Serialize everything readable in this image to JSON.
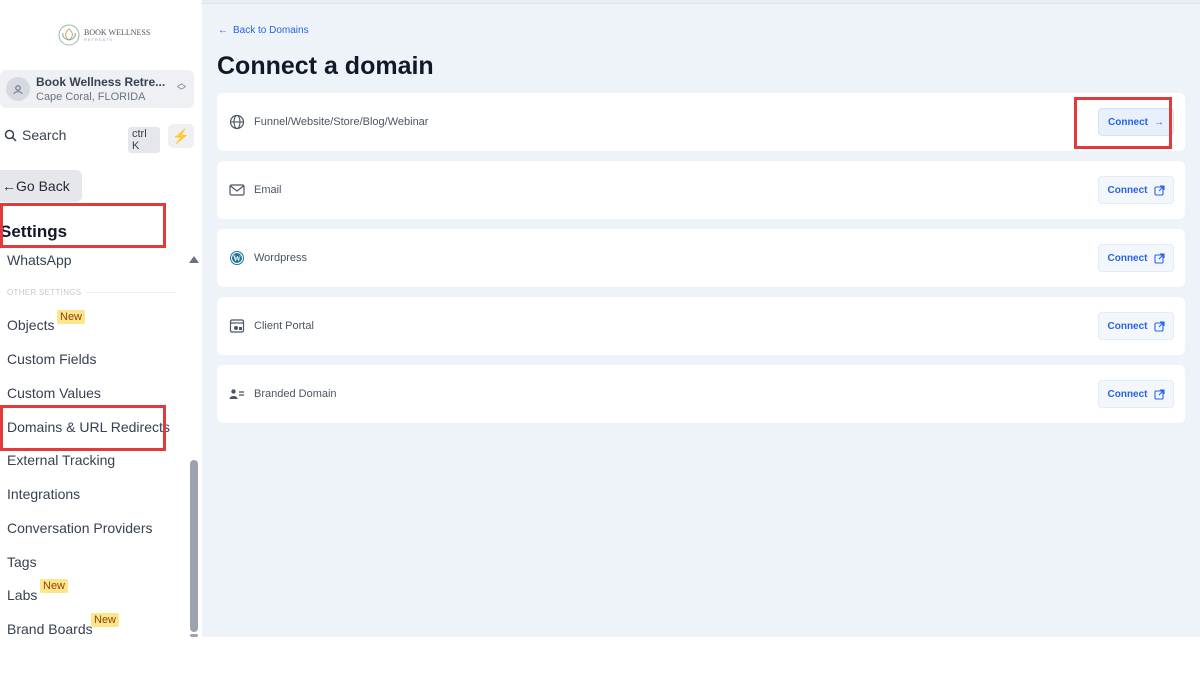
{
  "brand": {
    "logo_text": "BOOK WELLNESS",
    "logo_sub": "RETREATS"
  },
  "account": {
    "name": "Book Wellness Retre...",
    "location": "Cape Coral, FLORIDA"
  },
  "search": {
    "label": "Search",
    "shortcut": "ctrl K"
  },
  "sidebar": {
    "go_back": "Go Back",
    "settings_title": "Settings",
    "whatsapp": "WhatsApp",
    "other_settings_label": "OTHER SETTINGS",
    "items": [
      {
        "label": "Objects",
        "badge": "New"
      },
      {
        "label": "Custom Fields",
        "badge": ""
      },
      {
        "label": "Custom Values",
        "badge": ""
      },
      {
        "label": "Domains & URL Redirects",
        "badge": ""
      },
      {
        "label": "External Tracking",
        "badge": ""
      },
      {
        "label": "Integrations",
        "badge": ""
      },
      {
        "label": "Conversation Providers",
        "badge": ""
      },
      {
        "label": "Tags",
        "badge": ""
      },
      {
        "label": "Labs",
        "badge": "New"
      },
      {
        "label": "Brand Boards",
        "badge": "New"
      }
    ]
  },
  "main": {
    "back_link": "Back to Domains",
    "title": "Connect a domain",
    "cards": [
      {
        "label": "Funnel/Website/Store/Blog/Webinar",
        "icon": "globe-icon",
        "button": "Connect",
        "button_icon": "arrow-right-icon"
      },
      {
        "label": "Email",
        "icon": "mail-icon",
        "button": "Connect",
        "button_icon": "external-link-icon"
      },
      {
        "label": "Wordpress",
        "icon": "wordpress-icon",
        "button": "Connect",
        "button_icon": "external-link-icon"
      },
      {
        "label": "Client Portal",
        "icon": "portal-icon",
        "button": "Connect",
        "button_icon": "external-link-icon"
      },
      {
        "label": "Branded Domain",
        "icon": "branded-domain-icon",
        "button": "Connect",
        "button_icon": "external-link-icon"
      }
    ]
  },
  "colors": {
    "accent": "#2563eb",
    "highlight": "#e23a3a",
    "badge": "#fde68a",
    "main_bg": "#eef3f9"
  }
}
